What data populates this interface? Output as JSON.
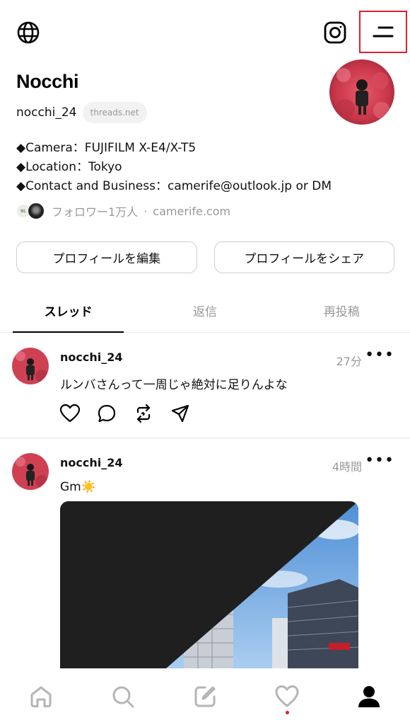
{
  "profile": {
    "name": "Nocchi",
    "handle": "nocchi_24",
    "domain": "threads.net",
    "bio": [
      "◆Camera：FUJIFILM X-E4/X-T5",
      "◆Location：Tokyo",
      "◆Contact and Business：camerife@outlook.jp or DM"
    ],
    "followers": "フォロワー1万人",
    "separator": "·",
    "link": "camerife.com",
    "mini_avatar_text": "NL"
  },
  "buttons": {
    "edit_profile": "プロフィールを編集",
    "share_profile": "プロフィールをシェア"
  },
  "tabs": [
    {
      "label": "スレッド",
      "active": true
    },
    {
      "label": "返信",
      "active": false
    },
    {
      "label": "再投稿",
      "active": false
    }
  ],
  "posts": [
    {
      "user": "nocchi_24",
      "time": "27分",
      "text": "ルンバさんって一周じゃ絶対に足りんよな",
      "more": "•••"
    },
    {
      "user": "nocchi_24",
      "time": "4時間",
      "text": "Gm☀️",
      "more": "•••"
    }
  ],
  "icons": {
    "top": [
      "globe-icon",
      "instagram-icon",
      "menu-icon"
    ],
    "post_actions": [
      "heart-icon",
      "comment-icon",
      "repost-icon",
      "share-icon"
    ],
    "nav": [
      "home-icon",
      "search-icon",
      "compose-icon",
      "activity-icon",
      "profile-icon"
    ]
  },
  "colors": {
    "highlight_border": "#e0202b",
    "notification_dot": "#e0202b",
    "muted_text": "#999999"
  }
}
